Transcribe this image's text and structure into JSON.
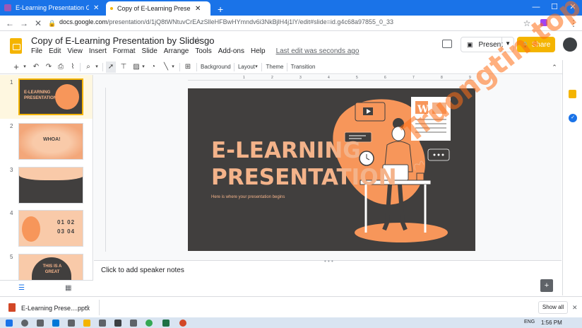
{
  "browser": {
    "tabs": [
      {
        "title": "E-Learning Presentation Google",
        "active": false
      },
      {
        "title": "Copy of E-Learning Presentation",
        "active": true
      }
    ],
    "url_host": "docs.google.com",
    "url_path": "/presentation/d/1jQ8tWNtuvCrEAzSlleHFBwHYmndv6i3NkBjlH4j1lY/edit#slide=id.g4c68a97855_0_33"
  },
  "doc": {
    "title": "Copy of E-Learning Presentation by Slidesgo",
    "menu": [
      "File",
      "Edit",
      "View",
      "Insert",
      "Format",
      "Slide",
      "Arrange",
      "Tools",
      "Add-ons",
      "Help"
    ],
    "last_edit": "Last edit was seconds ago",
    "present_label": "Present",
    "share_label": "Share"
  },
  "toolbar": {
    "background": "Background",
    "layout": "Layout",
    "theme": "Theme",
    "transition": "Transition"
  },
  "filmstrip": {
    "slides": [
      {
        "num": "1",
        "label": "E-LEARNING PRESENTATION"
      },
      {
        "num": "2",
        "label": "WHOA!"
      },
      {
        "num": "3",
        "label": ""
      },
      {
        "num": "4",
        "label": "01 02 03 04"
      },
      {
        "num": "5",
        "label": "THIS IS A GREAT"
      }
    ]
  },
  "slide": {
    "title_line1": "E-LEARNING",
    "title_line2": "PRESENTATION",
    "subtitle": "Here is where your presentation begins",
    "poster_letter": "W"
  },
  "notes": {
    "placeholder": "Click to add speaker notes"
  },
  "downloads": {
    "file_name": "E-Learning Prese....pptx",
    "show_all": "Show all"
  },
  "taskbar": {
    "lang": "ENG",
    "time": "1:56 PM"
  },
  "watermark": "Truongtin.top",
  "colors": {
    "accent_blue": "#1a73e8",
    "slides_yellow": "#f4b400",
    "slide_bg": "#413f3e",
    "slide_peach": "#f4b38a",
    "slide_orange": "#f7965a"
  }
}
